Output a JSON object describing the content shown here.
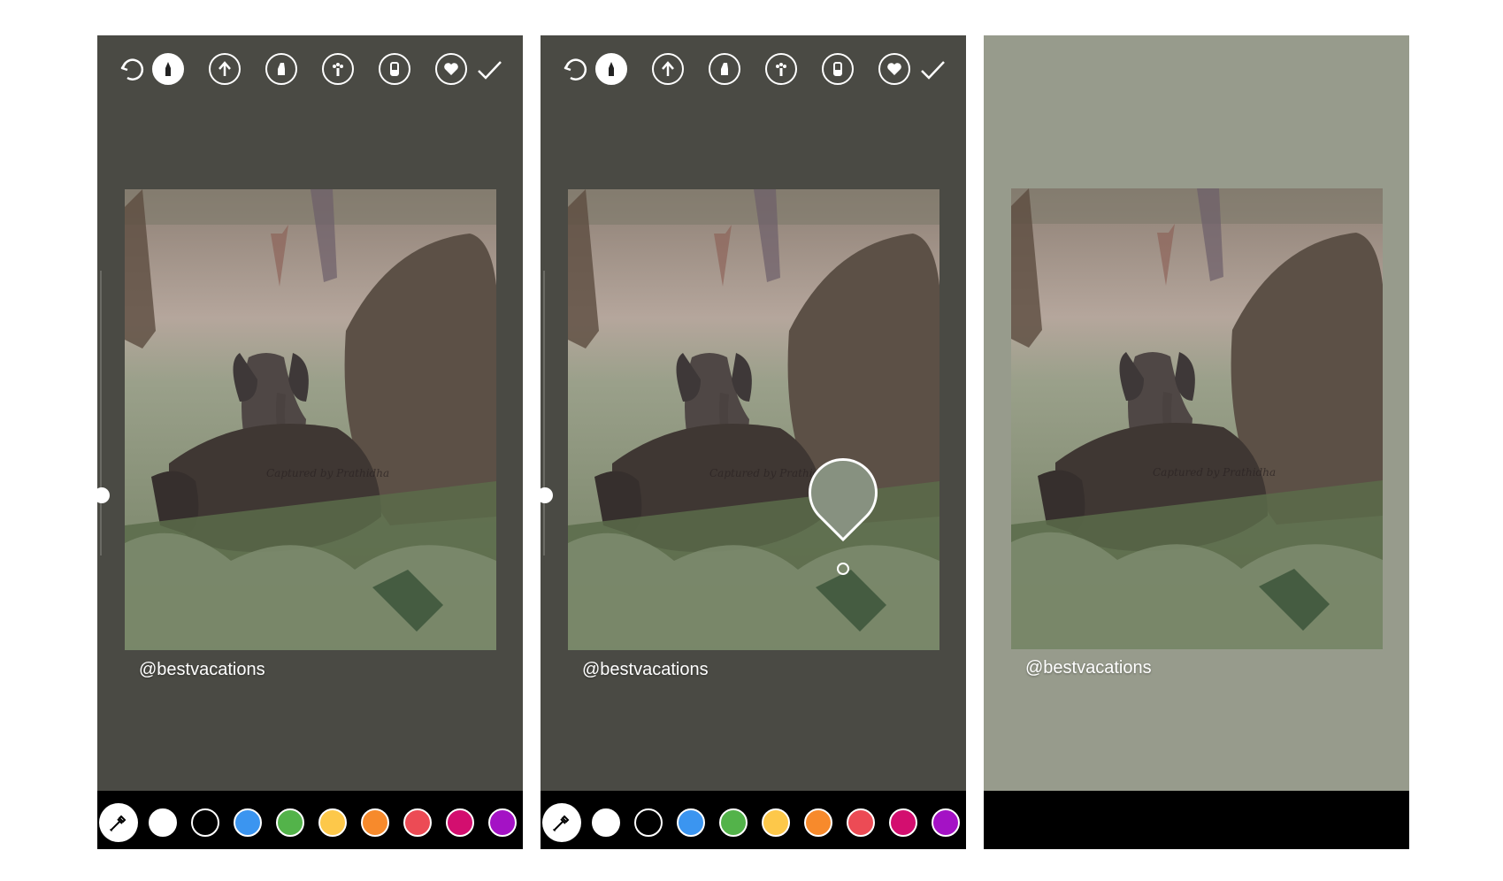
{
  "caption": "@bestvacations",
  "watermark": "Captured by Prathidha",
  "toolbar_icons": [
    "undo-icon",
    "pen-icon",
    "arrow-pen-icon",
    "marker-icon",
    "neon-icon",
    "eraser-icon",
    "sticker-heart-icon",
    "checkmark-icon"
  ],
  "palette": {
    "colors": [
      "#ffffff",
      "#000000",
      "#3b95f0",
      "#53b34a",
      "#fdc84a",
      "#f78a2c",
      "#ec4b55",
      "#d30e6f",
      "#a412c5"
    ],
    "picked_color": "#879180"
  },
  "panel_backgrounds": {
    "editor": "#4a4a44",
    "result": "#979b8c"
  }
}
